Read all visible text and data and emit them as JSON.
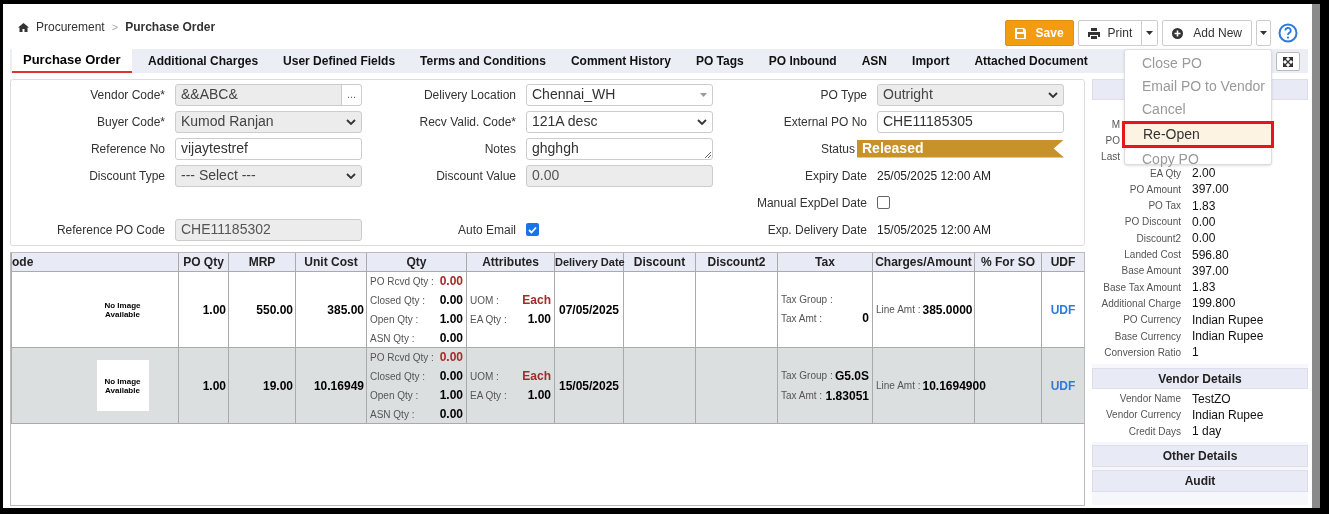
{
  "breadcrumb": {
    "items": [
      "Procurement",
      ">",
      "Purchase Order"
    ]
  },
  "toolbar": {
    "save": "Save",
    "print": "Print",
    "add_new": "Add New"
  },
  "tabs": [
    {
      "label": "Purchase Order",
      "selected": true
    },
    {
      "label": "Additional Charges",
      "selected": false
    },
    {
      "label": "User Defined Fields",
      "selected": false
    },
    {
      "label": "Terms and Conditions",
      "selected": false
    },
    {
      "label": "Comment History",
      "selected": false
    },
    {
      "label": "PO Tags",
      "selected": false
    },
    {
      "label": "PO Inbound",
      "selected": false
    },
    {
      "label": "ASN",
      "selected": false
    },
    {
      "label": "Import",
      "selected": false
    },
    {
      "label": "Attached Document",
      "selected": false
    }
  ],
  "form": {
    "rows": [
      [
        {
          "label": "Vendor Code*",
          "kind": "lookup",
          "value": "&&ABC&",
          "button": "..."
        },
        {
          "label": "Delivery Location",
          "kind": "combo",
          "value": "Chennai_WH"
        },
        {
          "label": "PO Type",
          "kind": "select",
          "value": "Outright",
          "disabled": true
        }
      ],
      [
        {
          "label": "Buyer Code*",
          "kind": "select",
          "value": "Kumod Ranjan",
          "disabled": true
        },
        {
          "label": "Recv Valid. Code*",
          "kind": "select",
          "value": "121A desc",
          "disabled": false
        },
        {
          "label": "External PO No",
          "kind": "input",
          "value": "CHE11185305",
          "disabled": false
        }
      ],
      [
        {
          "label": "Reference No",
          "kind": "input",
          "value": "vijaytestref",
          "disabled": false
        },
        {
          "label": "Notes",
          "kind": "textarea",
          "value": "ghghgh"
        },
        {
          "label": "Status",
          "kind": "badge",
          "value": "Released"
        }
      ],
      [
        {
          "label": "Discount Type",
          "kind": "select",
          "value": "--- Select ---",
          "disabled": true
        },
        {
          "label": "Discount Value",
          "kind": "input",
          "value": "0.00",
          "disabled": true
        },
        {
          "label": "Expiry Date",
          "kind": "text",
          "value": "25/05/2025 12:00 AM"
        }
      ],
      [
        null,
        null,
        {
          "label": "Manual ExpDel Date",
          "kind": "checkbox",
          "checked": false
        }
      ],
      [
        {
          "label": "Reference PO Code",
          "kind": "input",
          "value": "CHE11185302",
          "disabled": true
        },
        {
          "label": "Auto Email",
          "kind": "checkbox",
          "checked": true
        },
        {
          "label": "Exp. Delivery Date",
          "kind": "text",
          "value": "15/05/2025 12:00 AM"
        }
      ]
    ]
  },
  "table": {
    "columns": [
      "ode",
      "PO Qty",
      "MRP",
      "Unit Cost",
      "Qty",
      "Attributes",
      "Delivery Date",
      "Discount",
      "Discount2",
      "Tax",
      "Charges/Amount",
      "% For SO",
      "UDF"
    ],
    "rows": [
      {
        "selected": false,
        "image_text": "No Image Available",
        "po_qty": "1.00",
        "mrp": "550.00",
        "unit_cost": "385.00",
        "qty": [
          {
            "label": "PO Rcvd Qty :",
            "value": "0.00"
          },
          {
            "label": "Closed Qty :",
            "value": "0.00"
          },
          {
            "label": "Open Qty :",
            "value": "1.00"
          },
          {
            "label": "ASN Qty :",
            "value": "0.00"
          }
        ],
        "attributes": [
          {
            "label": "UOM :",
            "value": "Each"
          },
          {
            "label": "EA Qty :",
            "value": "1.00"
          }
        ],
        "delivery_date": "07/05/2025",
        "tax": [
          {
            "label": "Tax Group :"
          },
          {
            "label": "Tax Amt :",
            "value": "0"
          }
        ],
        "charges": {
          "label": "Line Amt :",
          "value": "385.0000"
        },
        "udf": "UDF"
      },
      {
        "selected": true,
        "image_text": "No Image Available",
        "po_qty": "1.00",
        "mrp": "19.00",
        "unit_cost": "10.16949",
        "qty": [
          {
            "label": "PO Rcvd Qty :",
            "value": "0.00"
          },
          {
            "label": "Closed Qty :",
            "value": "0.00"
          },
          {
            "label": "Open Qty :",
            "value": "1.00"
          },
          {
            "label": "ASN Qty :",
            "value": "0.00"
          }
        ],
        "attributes": [
          {
            "label": "UOM :",
            "value": "Each"
          },
          {
            "label": "EA Qty :",
            "value": "1.00"
          }
        ],
        "delivery_date": "15/05/2025",
        "tax": [
          {
            "label": "Tax Group :",
            "value": "G5.0S"
          },
          {
            "label": "Tax Amt :",
            "value": "1.83051"
          }
        ],
        "charges": {
          "label": "Line Amt :",
          "value": "10.1694900"
        },
        "udf": "UDF"
      }
    ]
  },
  "summary": {
    "rows": [
      {
        "label": "M",
        "cut": true
      },
      {
        "label": "PO",
        "cut": true
      },
      {
        "label": "Last",
        "cut": true
      },
      {
        "label": "EA Qty",
        "value": "2.00"
      },
      {
        "label": "PO Amount",
        "value": "397.00"
      },
      {
        "label": "PO Tax",
        "value": "1.83"
      },
      {
        "label": "PO Discount",
        "value": "0.00"
      },
      {
        "label": "Discount2",
        "value": "0.00"
      },
      {
        "label": "Landed Cost",
        "value": "596.80"
      },
      {
        "label": "Base Amount",
        "value": "397.00"
      },
      {
        "label": "Base Tax Amount",
        "value": "1.83"
      },
      {
        "label": "Additional Charge",
        "value": "199.800"
      },
      {
        "label": "PO Currency",
        "value": "Indian Rupee"
      },
      {
        "label": "Base Currency",
        "value": "Indian Rupee"
      },
      {
        "label": "Conversion Ratio",
        "value": "1"
      }
    ]
  },
  "vendor_details": {
    "title": "Vendor Details",
    "rows": [
      {
        "label": "Vendor Name",
        "value": "TestZO"
      },
      {
        "label": "Vendor Currency",
        "value": "Indian Rupee"
      },
      {
        "label": "Credit Days",
        "value": "1 day"
      }
    ]
  },
  "sections": [
    "Other Details",
    "Audit"
  ],
  "menu": {
    "items": [
      {
        "label": "Close PO",
        "highlighted": false
      },
      {
        "label": "Email PO to Vendor",
        "highlighted": false
      },
      {
        "label": "Cancel",
        "highlighted": false
      },
      {
        "label": "Re-Open",
        "highlighted": true
      },
      {
        "label": "Copy PO",
        "highlighted": false
      }
    ]
  }
}
